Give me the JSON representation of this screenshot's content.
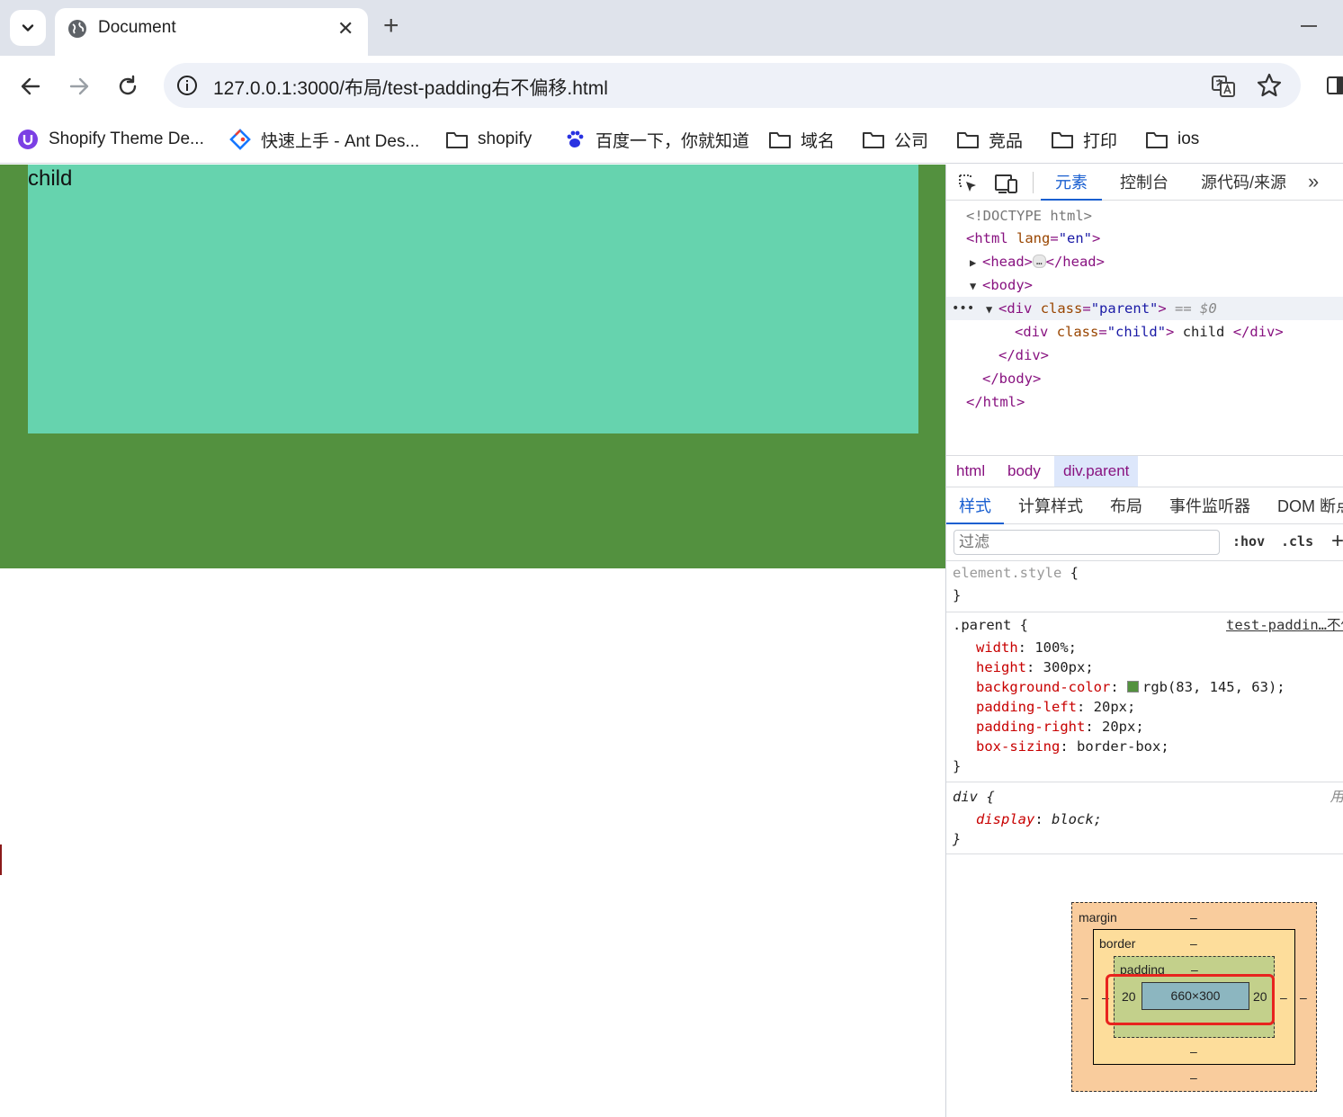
{
  "browser": {
    "tab_title": "Document",
    "url": "127.0.0.1:3000/布局/test-padding右不偏移.html"
  },
  "bookmarks": [
    {
      "label": "Shopify Theme De...",
      "icon": "shopify-icon"
    },
    {
      "label": "快速上手 - Ant Des...",
      "icon": "ant-design-icon"
    },
    {
      "label": "shopify",
      "icon": "folder-icon"
    },
    {
      "label": "百度一下，你就知道",
      "icon": "baidu-icon"
    },
    {
      "label": "域名",
      "icon": "folder-icon"
    },
    {
      "label": "公司",
      "icon": "folder-icon"
    },
    {
      "label": "竞品",
      "icon": "folder-icon"
    },
    {
      "label": "打印",
      "icon": "folder-icon"
    },
    {
      "label": "ios",
      "icon": "folder-icon"
    }
  ],
  "page": {
    "child_text": "child",
    "parent_color": "#53913f",
    "child_color": "#66d3ae"
  },
  "devtools": {
    "tabs": [
      "元素",
      "控制台",
      "源代码/来源"
    ],
    "active_tab": "元素",
    "dom": {
      "doctype": "<!DOCTYPE html>",
      "html_open_tag": "html",
      "html_attr": "lang",
      "html_attr_val": "\"en\"",
      "head_open": "<head>",
      "head_ellipsis": "…",
      "head_close": "</head>",
      "body_open": "<body>",
      "div_parent_tag": "div",
      "div_parent_attr": "class",
      "div_parent_val": "\"parent\"",
      "selected_marker": "== $0",
      "div_child_tag": "div",
      "div_child_attr": "class",
      "div_child_val": "\"child\"",
      "div_child_text": " child ",
      "div_close": "</div>",
      "body_close": "</body>",
      "html_close": "</html>"
    },
    "breadcrumbs": [
      "html",
      "body",
      "div.parent"
    ],
    "sub_tabs": [
      "样式",
      "计算样式",
      "布局",
      "事件监听器",
      "DOM 断点"
    ],
    "filter_placeholder": "过滤",
    "hov_label": ":hov",
    "cls_label": ".cls",
    "plus_label": "+",
    "styles": {
      "element_style_selector": "element.style",
      "parent_selector": ".parent",
      "parent_source": "test-paddin…不偏",
      "parent_props": [
        {
          "name": "width",
          "value": "100%;"
        },
        {
          "name": "height",
          "value": "300px;"
        },
        {
          "name": "background-color",
          "value": "rgb(83, 145, 63);"
        },
        {
          "name": "padding-left",
          "value": "20px;"
        },
        {
          "name": "padding-right",
          "value": "20px;"
        },
        {
          "name": "box-sizing",
          "value": "border-box;"
        }
      ],
      "ua_selector": "div",
      "ua_source": "用",
      "ua_props": [
        {
          "name": "display",
          "value": "block;"
        }
      ]
    },
    "box_model": {
      "margin_label": "margin",
      "border_label": "border",
      "padding_label": "padding",
      "dash": "–",
      "padding_left": "20",
      "padding_right": "20",
      "content_size": "660×300"
    }
  }
}
